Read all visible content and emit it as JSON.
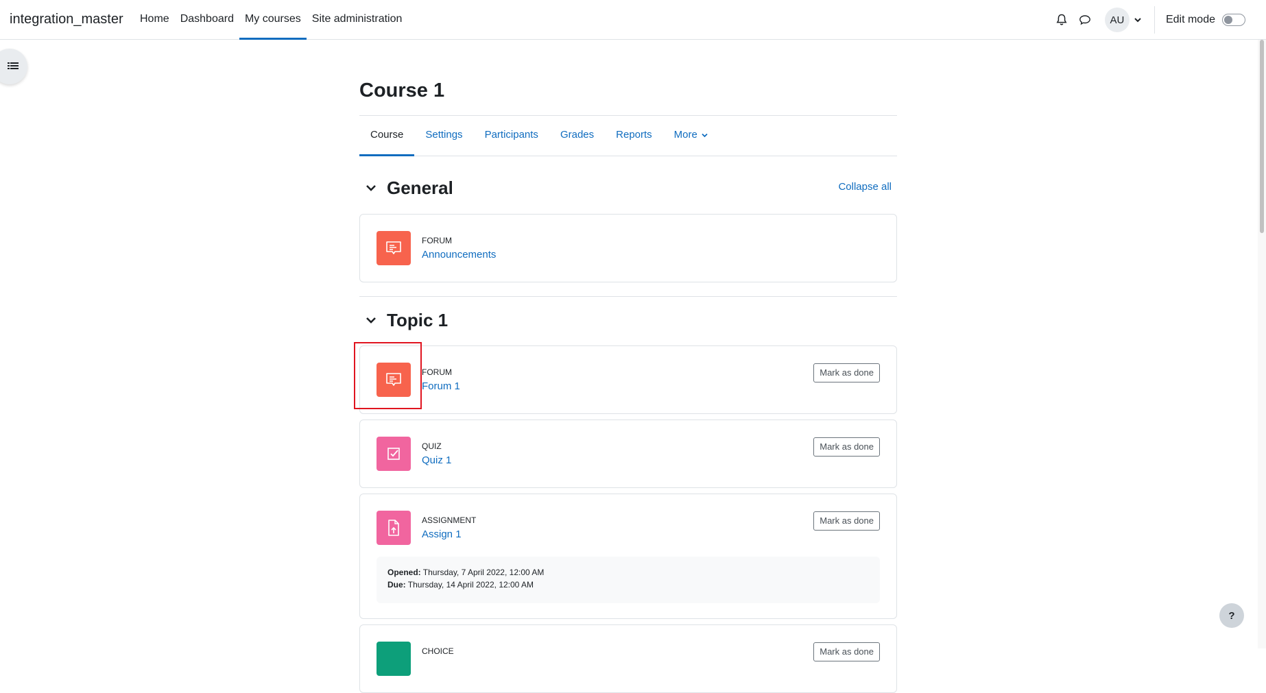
{
  "navbar": {
    "brand": "integration_master",
    "items": [
      {
        "label": "Home",
        "active": false
      },
      {
        "label": "Dashboard",
        "active": false
      },
      {
        "label": "My courses",
        "active": true
      },
      {
        "label": "Site administration",
        "active": false
      }
    ],
    "icons": [
      "bell-icon",
      "chat-icon"
    ],
    "user_initials": "AU",
    "edit_mode_label": "Edit mode",
    "edit_mode_on": false
  },
  "course": {
    "title": "Course 1",
    "tabs": [
      {
        "label": "Course",
        "active": true
      },
      {
        "label": "Settings",
        "active": false
      },
      {
        "label": "Participants",
        "active": false
      },
      {
        "label": "Grades",
        "active": false
      },
      {
        "label": "Reports",
        "active": false
      },
      {
        "label": "More",
        "active": false
      }
    ]
  },
  "sections": {
    "collapse_all": "Collapse all",
    "general": {
      "title": "General",
      "activities": [
        {
          "type": "FORUM",
          "name": "Announcements"
        }
      ]
    },
    "topic1": {
      "title": "Topic 1",
      "activities": [
        {
          "type": "FORUM",
          "name": "Forum 1",
          "button": "Mark as done"
        },
        {
          "type": "QUIZ",
          "name": "Quiz 1",
          "button": "Mark as done"
        },
        {
          "type": "ASSIGNMENT",
          "name": "Assign 1",
          "button": "Mark as done",
          "opened_label": "Opened:",
          "opened": "Thursday, 7 April 2022, 12:00 AM",
          "due_label": "Due:",
          "due": "Thursday, 14 April 2022, 12:00 AM"
        },
        {
          "type": "CHOICE",
          "name": "",
          "button": "Mark as done"
        }
      ]
    }
  },
  "help": "?",
  "colors": {
    "primary": "#0f6cbf",
    "forum": "#f7634d",
    "quiz": "#f1659f",
    "assignment": "#f1659f",
    "choice": "#0d9f7a",
    "highlight": "#e0141f"
  }
}
